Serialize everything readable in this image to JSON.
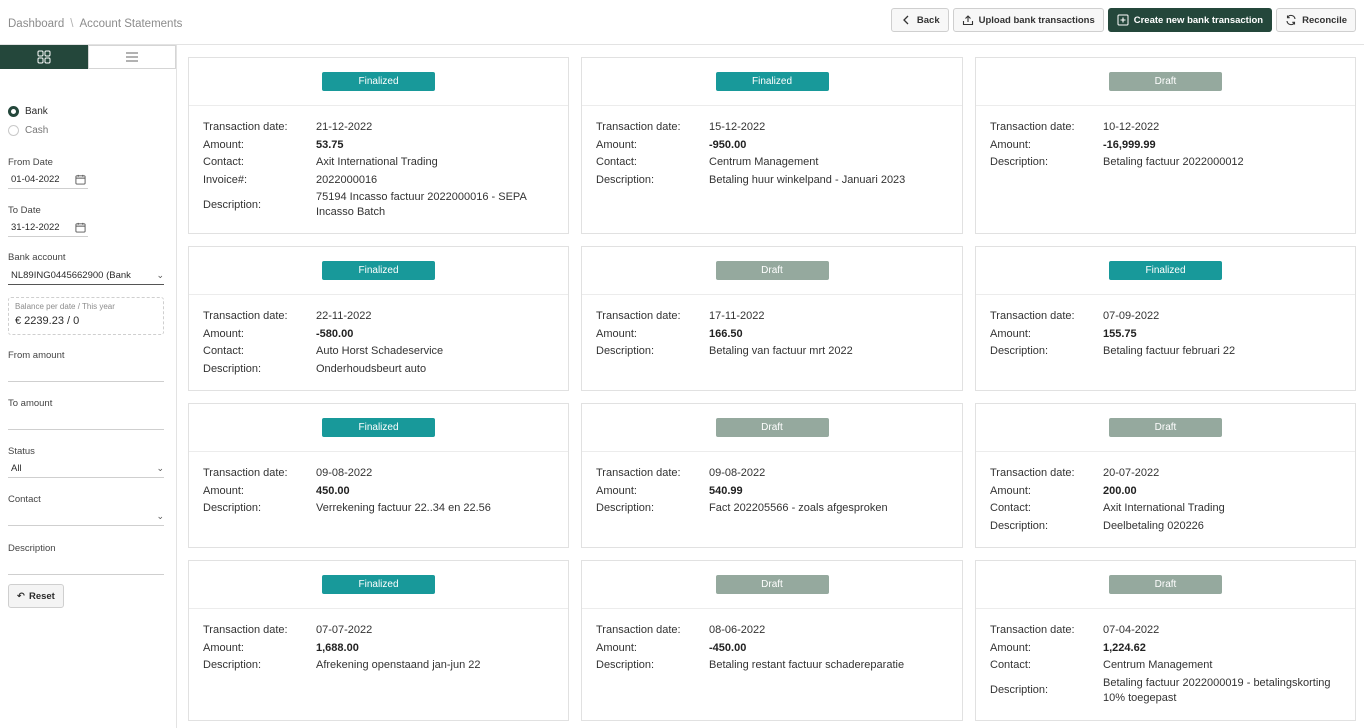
{
  "breadcrumb": [
    "Dashboard",
    "Account Statements"
  ],
  "actions": {
    "back": "Back",
    "upload": "Upload bank transactions",
    "create": "Create new bank transaction",
    "reconcile": "Reconcile"
  },
  "sidebar": {
    "type_bank": "Bank",
    "type_cash": "Cash",
    "from_date_label": "From Date",
    "from_date": "01-04-2022",
    "to_date_label": "To Date",
    "to_date": "31-12-2022",
    "bank_account_label": "Bank account",
    "bank_account": "NL89ING0445662900 (Bank",
    "balance_label": "Balance per date / This year",
    "balance_value": "€ 2239.23 / 0",
    "from_amount_label": "From amount",
    "to_amount_label": "To amount",
    "status_label": "Status",
    "status_value": "All",
    "contact_label": "Contact",
    "description_label": "Description",
    "reset": "Reset"
  },
  "labels": {
    "date": "Transaction date:",
    "amount": "Amount:",
    "contact": "Contact:",
    "invoice": "Invoice#:",
    "description": "Description:"
  },
  "cards": [
    {
      "status": "Finalized",
      "date": "21-12-2022",
      "amount": "53.75",
      "contact": "Axit International Trading",
      "invoice": "2022000016",
      "description": "75194 Incasso factuur 2022000016 - SEPA Incasso Batch"
    },
    {
      "status": "Finalized",
      "date": "15-12-2022",
      "amount": "-950.00",
      "contact": "Centrum Management",
      "description": "Betaling huur winkelpand - Januari 2023"
    },
    {
      "status": "Draft",
      "date": "10-12-2022",
      "amount": "-16,999.99",
      "description": "Betaling factuur 2022000012"
    },
    {
      "status": "Finalized",
      "date": "22-11-2022",
      "amount": "-580.00",
      "contact": "Auto Horst Schadeservice",
      "description": "Onderhoudsbeurt auto"
    },
    {
      "status": "Draft",
      "date": "17-11-2022",
      "amount": "166.50",
      "description": "Betaling van factuur mrt 2022"
    },
    {
      "status": "Finalized",
      "date": "07-09-2022",
      "amount": "155.75",
      "description": "Betaling factuur februari 22"
    },
    {
      "status": "Finalized",
      "date": "09-08-2022",
      "amount": "450.00",
      "description": "Verrekening factuur 22..34 en 22.56"
    },
    {
      "status": "Draft",
      "date": "09-08-2022",
      "amount": "540.99",
      "description": "Fact 202205566 - zoals afgesproken"
    },
    {
      "status": "Draft",
      "date": "20-07-2022",
      "amount": "200.00",
      "contact": "Axit International Trading",
      "description": "Deelbetaling 020226"
    },
    {
      "status": "Finalized",
      "date": "07-07-2022",
      "amount": "1,688.00",
      "description": "Afrekening openstaand jan-jun 22"
    },
    {
      "status": "Draft",
      "date": "08-06-2022",
      "amount": "-450.00",
      "description": "Betaling restant factuur schadereparatie"
    },
    {
      "status": "Draft",
      "date": "07-04-2022",
      "amount": "1,224.62",
      "contact": "Centrum Management",
      "description": "Betaling factuur 2022000019 - betalingskorting 10% toegepast"
    }
  ]
}
